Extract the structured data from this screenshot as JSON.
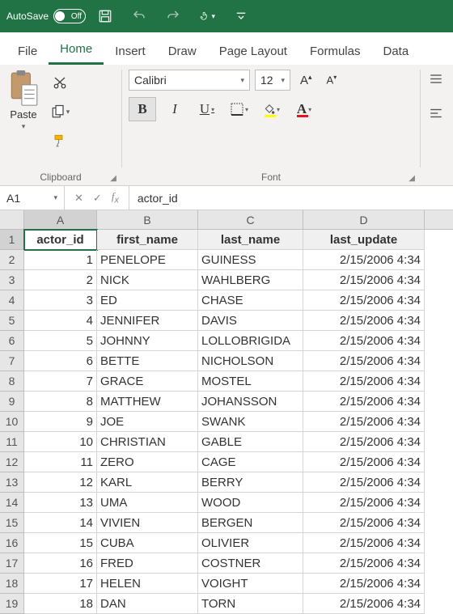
{
  "titlebar": {
    "autosave_label": "AutoSave",
    "autosave_state": "Off"
  },
  "menu": {
    "tabs": [
      "File",
      "Home",
      "Insert",
      "Draw",
      "Page Layout",
      "Formulas",
      "Data"
    ],
    "active": "Home"
  },
  "ribbon": {
    "clipboard_label": "Clipboard",
    "paste_label": "Paste",
    "font_label": "Font",
    "font_name": "Calibri",
    "font_size": "12"
  },
  "formula_bar": {
    "cell_ref": "A1",
    "formula": "actor_id"
  },
  "grid": {
    "columns": [
      "A",
      "B",
      "C",
      "D"
    ],
    "headers": [
      "actor_id",
      "first_name",
      "last_name",
      "last_update"
    ],
    "rows": [
      {
        "id": "1",
        "first": "PENELOPE",
        "last": "GUINESS",
        "upd": "2/15/2006 4:34"
      },
      {
        "id": "2",
        "first": "NICK",
        "last": "WAHLBERG",
        "upd": "2/15/2006 4:34"
      },
      {
        "id": "3",
        "first": "ED",
        "last": "CHASE",
        "upd": "2/15/2006 4:34"
      },
      {
        "id": "4",
        "first": "JENNIFER",
        "last": "DAVIS",
        "upd": "2/15/2006 4:34"
      },
      {
        "id": "5",
        "first": "JOHNNY",
        "last": "LOLLOBRIGIDA",
        "upd": "2/15/2006 4:34"
      },
      {
        "id": "6",
        "first": "BETTE",
        "last": "NICHOLSON",
        "upd": "2/15/2006 4:34"
      },
      {
        "id": "7",
        "first": "GRACE",
        "last": "MOSTEL",
        "upd": "2/15/2006 4:34"
      },
      {
        "id": "8",
        "first": "MATTHEW",
        "last": "JOHANSSON",
        "upd": "2/15/2006 4:34"
      },
      {
        "id": "9",
        "first": "JOE",
        "last": "SWANK",
        "upd": "2/15/2006 4:34"
      },
      {
        "id": "10",
        "first": "CHRISTIAN",
        "last": "GABLE",
        "upd": "2/15/2006 4:34"
      },
      {
        "id": "11",
        "first": "ZERO",
        "last": "CAGE",
        "upd": "2/15/2006 4:34"
      },
      {
        "id": "12",
        "first": "KARL",
        "last": "BERRY",
        "upd": "2/15/2006 4:34"
      },
      {
        "id": "13",
        "first": "UMA",
        "last": "WOOD",
        "upd": "2/15/2006 4:34"
      },
      {
        "id": "14",
        "first": "VIVIEN",
        "last": "BERGEN",
        "upd": "2/15/2006 4:34"
      },
      {
        "id": "15",
        "first": "CUBA",
        "last": "OLIVIER",
        "upd": "2/15/2006 4:34"
      },
      {
        "id": "16",
        "first": "FRED",
        "last": "COSTNER",
        "upd": "2/15/2006 4:34"
      },
      {
        "id": "17",
        "first": "HELEN",
        "last": "VOIGHT",
        "upd": "2/15/2006 4:34"
      },
      {
        "id": "18",
        "first": "DAN",
        "last": "TORN",
        "upd": "2/15/2006 4:34"
      }
    ]
  }
}
